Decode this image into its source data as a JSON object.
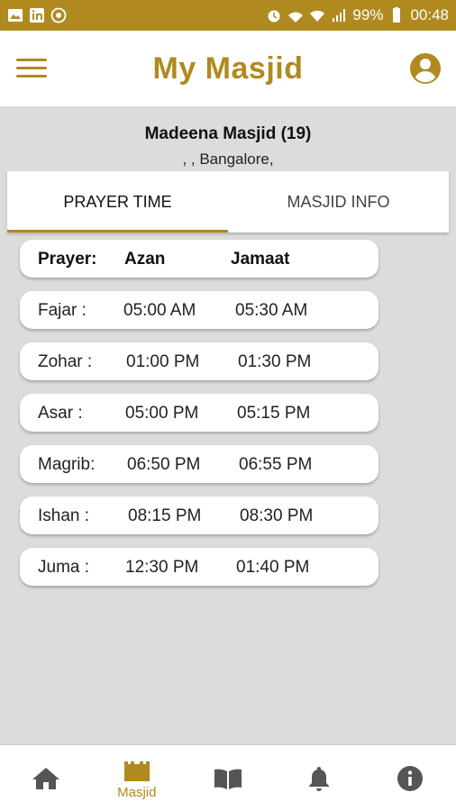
{
  "status_bar": {
    "battery": "99%",
    "time": "00:48",
    "left_icons": [
      "gallery-icon",
      "linkedin-icon",
      "whatsapp-icon"
    ],
    "right_icons": [
      "alarm-icon",
      "vowifi-icon",
      "wifi-icon",
      "signal-icon",
      "battery-icon"
    ]
  },
  "app_bar": {
    "title": "My Masjid",
    "left_icon": "hamburger-menu-icon",
    "right_icon": "account-circle-icon"
  },
  "masjid": {
    "name": "Madeena Masjid (19)",
    "address": ", , Bangalore,"
  },
  "tabs": [
    {
      "label": "PRAYER TIME",
      "active": true
    },
    {
      "label": "MASJID INFO",
      "active": false
    }
  ],
  "prayer_table": {
    "headers": {
      "prayer": "Prayer:",
      "azan": "Azan",
      "jamaat": "Jamaat"
    },
    "rows": [
      {
        "prayer": "Fajar   :",
        "azan": "05:00 AM",
        "jamaat": "05:30 AM"
      },
      {
        "prayer": "Zohar  :",
        "azan": "01:00 PM",
        "jamaat": "01:30 PM"
      },
      {
        "prayer": "Asar    :",
        "azan": "05:00 PM",
        "jamaat": "05:15 PM"
      },
      {
        "prayer": "Magrib:",
        "azan": "06:50 PM",
        "jamaat": "06:55 PM"
      },
      {
        "prayer": "Ishan   :",
        "azan": "08:15 PM",
        "jamaat": "08:30 PM"
      },
      {
        "prayer": "Juma  :",
        "azan": "12:30 PM",
        "jamaat": "01:40 PM"
      }
    ]
  },
  "bottom_nav": [
    {
      "icon": "home-icon",
      "label": ""
    },
    {
      "icon": "masjid-icon",
      "label": "Masjid",
      "active": true
    },
    {
      "icon": "book-icon",
      "label": ""
    },
    {
      "icon": "bell-icon",
      "label": ""
    },
    {
      "icon": "info-icon",
      "label": ""
    }
  ],
  "colors": {
    "accent": "#b08a1f",
    "background": "#dcdcdc",
    "card": "#ffffff"
  }
}
